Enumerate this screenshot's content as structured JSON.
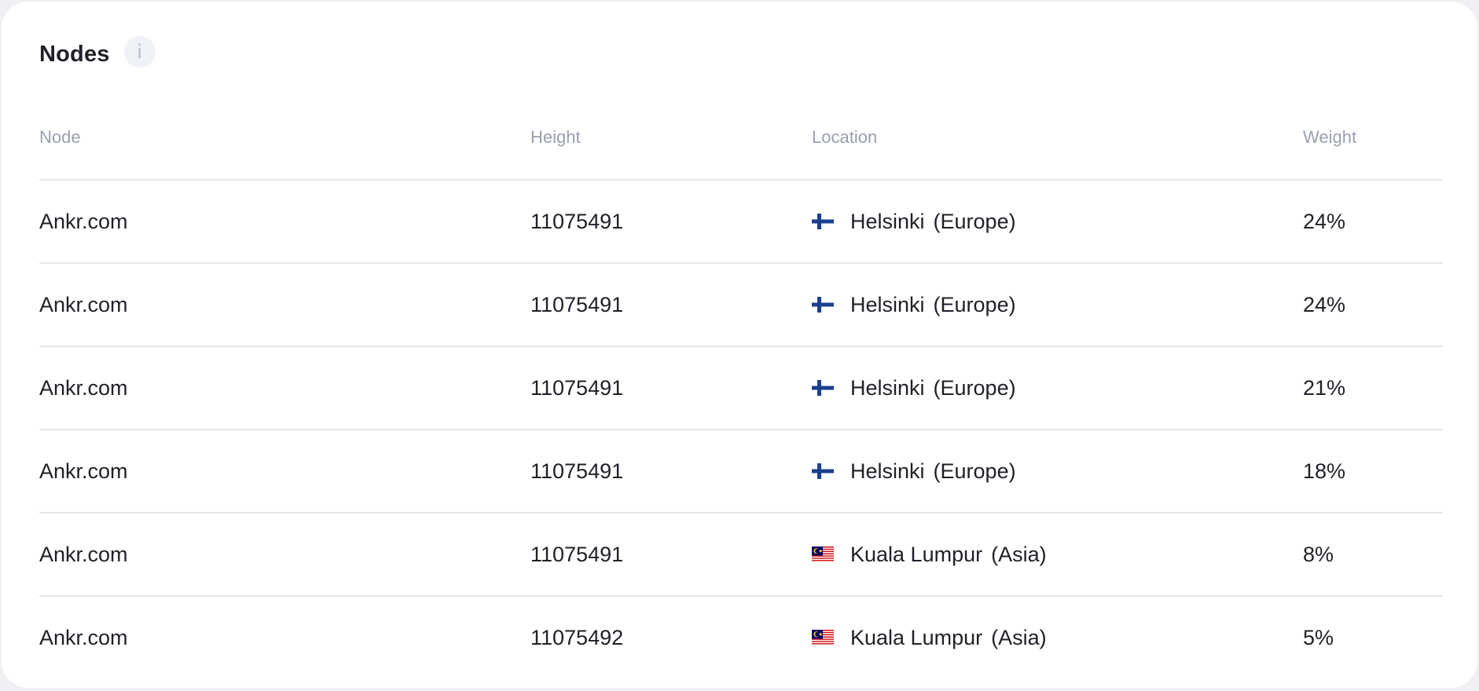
{
  "panel": {
    "title": "Nodes",
    "info_icon": "info-icon",
    "info_glyph": "i"
  },
  "table": {
    "columns": [
      "Node",
      "Height",
      "Location",
      "Weight"
    ],
    "rows": [
      {
        "node": "Ankr.com",
        "height": "11075491",
        "flag": "finland-flag-icon",
        "city": "Helsinki",
        "region": "(Europe)",
        "weight": "24%"
      },
      {
        "node": "Ankr.com",
        "height": "11075491",
        "flag": "finland-flag-icon",
        "city": "Helsinki",
        "region": "(Europe)",
        "weight": "24%"
      },
      {
        "node": "Ankr.com",
        "height": "11075491",
        "flag": "finland-flag-icon",
        "city": "Helsinki",
        "region": "(Europe)",
        "weight": "21%"
      },
      {
        "node": "Ankr.com",
        "height": "11075491",
        "flag": "finland-flag-icon",
        "city": "Helsinki",
        "region": "(Europe)",
        "weight": "18%"
      },
      {
        "node": "Ankr.com",
        "height": "11075491",
        "flag": "malaysia-flag-icon",
        "city": "Kuala Lumpur",
        "region": "(Asia)",
        "weight": "8%"
      },
      {
        "node": "Ankr.com",
        "height": "11075492",
        "flag": "malaysia-flag-icon",
        "city": "Kuala Lumpur",
        "region": "(Asia)",
        "weight": "5%"
      }
    ]
  },
  "colors": {
    "text": "#1f2029",
    "header_text": "#9aa0b0",
    "divider": "#e4e6ea",
    "finland_blue": "#1b3f8f",
    "malaysia_red": "#cc0001",
    "malaysia_blue": "#010066",
    "malaysia_yellow": "#ffcc00"
  }
}
